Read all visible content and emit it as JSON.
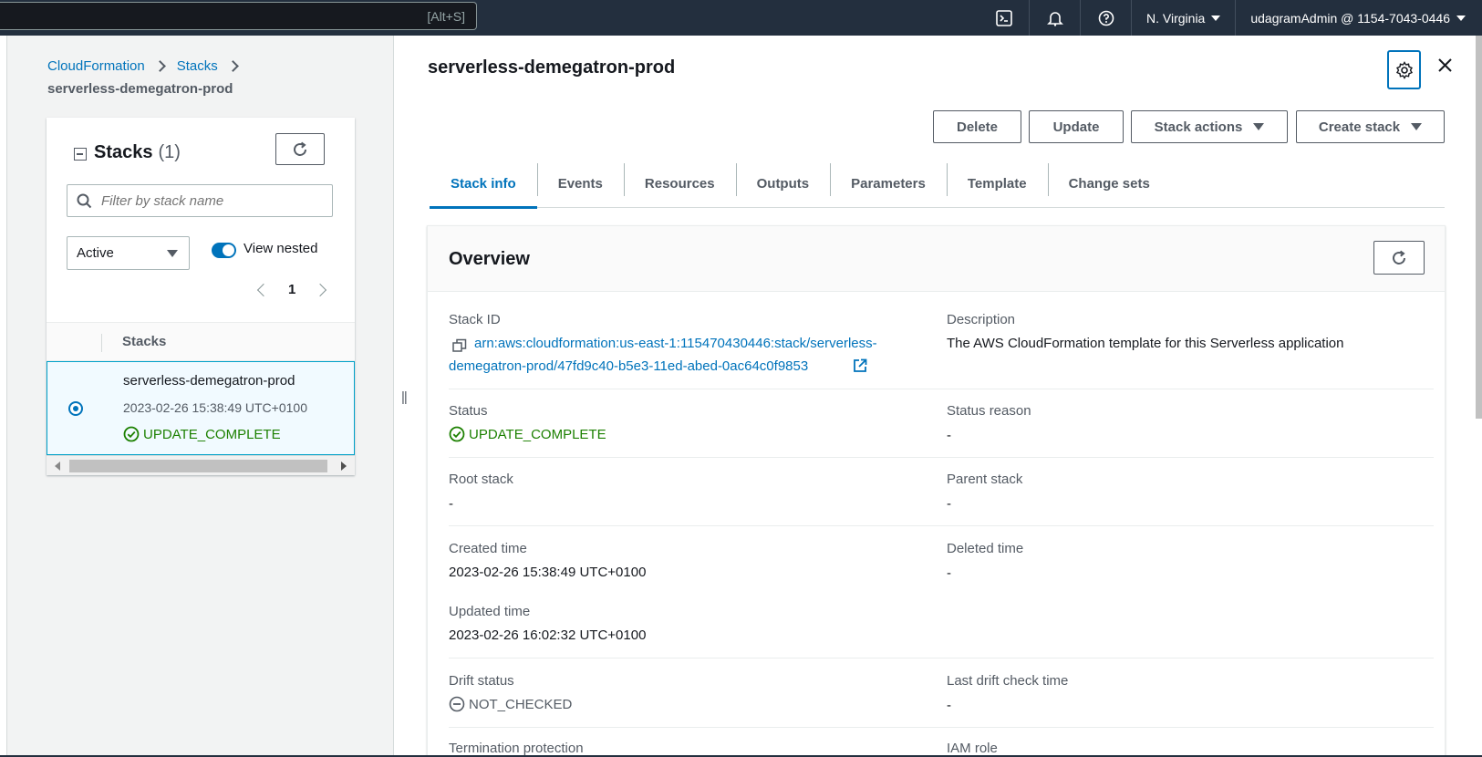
{
  "topnav": {
    "search_shortcut": "[Alt+S]",
    "icons": [
      "cloudshell-icon",
      "bell-icon",
      "help-icon"
    ],
    "region": "N. Virginia",
    "account": "udagramAdmin @ 1154-7043-0446"
  },
  "breadcrumb": {
    "items": [
      "CloudFormation",
      "Stacks"
    ],
    "current": "serverless-demegatron-prod"
  },
  "stacks_panel": {
    "title": "Stacks",
    "count": "(1)",
    "filter_placeholder": "Filter by stack name",
    "status_filter": "Active",
    "view_nested_label": "View nested",
    "view_nested_on": true,
    "page": "1",
    "column_header": "Stacks",
    "rows": [
      {
        "name": "serverless-demegatron-prod",
        "date": "2023-02-26 15:38:49 UTC+0100",
        "status": "UPDATE_COMPLETE",
        "selected": true
      }
    ]
  },
  "detail": {
    "title": "serverless-demegatron-prod",
    "actions": {
      "delete": "Delete",
      "update": "Update",
      "stack_actions": "Stack actions",
      "create_stack": "Create stack"
    },
    "tabs": [
      "Stack info",
      "Events",
      "Resources",
      "Outputs",
      "Parameters",
      "Template",
      "Change sets"
    ],
    "active_tab": "Stack info",
    "overview": {
      "title": "Overview",
      "stack_id_label": "Stack ID",
      "stack_id_line1": "arn:aws:cloudformation:us-east-1:115470430446:stack/serverless-",
      "stack_id_line2": "demegatron-prod/47fd9c40-b5e3-11ed-abed-0ac64c0f9853",
      "description_label": "Description",
      "description": "The AWS CloudFormation template for this Serverless application",
      "status_label": "Status",
      "status": "UPDATE_COMPLETE",
      "status_reason_label": "Status reason",
      "status_reason": "-",
      "root_stack_label": "Root stack",
      "root_stack": "-",
      "parent_stack_label": "Parent stack",
      "parent_stack": "-",
      "created_label": "Created time",
      "created": "2023-02-26 15:38:49 UTC+0100",
      "deleted_label": "Deleted time",
      "deleted": "-",
      "updated_label": "Updated time",
      "updated": "2023-02-26 16:02:32 UTC+0100",
      "drift_label": "Drift status",
      "drift": "NOT_CHECKED",
      "last_drift_label": "Last drift check time",
      "last_drift": "-",
      "termination_label": "Termination protection",
      "iam_role_label": "IAM role"
    }
  },
  "colors": {
    "nav_bg": "#232f3e",
    "link": "#0073bb",
    "success": "#1d8102",
    "panel_bg": "#f2f3f3"
  }
}
